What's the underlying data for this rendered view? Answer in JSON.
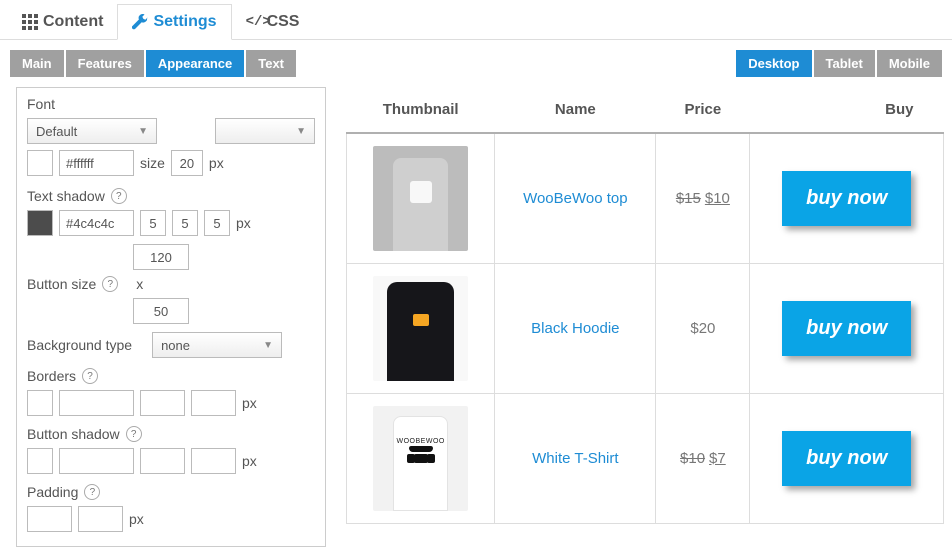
{
  "topTabs": {
    "content": "Content",
    "settings": "Settings",
    "css": "CSS"
  },
  "subTabs": {
    "main": "Main",
    "features": "Features",
    "appearance": "Appearance",
    "text": "Text"
  },
  "devTabs": {
    "desktop": "Desktop",
    "tablet": "Tablet",
    "mobile": "Mobile"
  },
  "labels": {
    "font": "Font",
    "size": "size",
    "px": "px",
    "textShadow": "Text shadow",
    "buttonSize": "Button size",
    "x": "x",
    "backgroundType": "Background type",
    "borders": "Borders",
    "buttonShadow": "Button shadow",
    "padding": "Padding"
  },
  "form": {
    "fontSelect": "Default",
    "fontColor": "#ffffff",
    "fontSize": "20",
    "shadowColor": "#4c4c4c",
    "shadowA": "5",
    "shadowB": "5",
    "shadowC": "5",
    "btnW": "120",
    "btnH": "50",
    "bgType": "none"
  },
  "table": {
    "headers": {
      "thumbnail": "Thumbnail",
      "name": "Name",
      "price": "Price",
      "buy": "Buy"
    },
    "buyLabel": "buy now",
    "rows": [
      {
        "name": "WooBeWoo top",
        "old": "$15",
        "new": "$10",
        "thumb": "tee-grey"
      },
      {
        "name": "Black Hoodie",
        "price": "$20",
        "thumb": "hdy"
      },
      {
        "name": "White T-Shirt",
        "old": "$10",
        "new": "$7",
        "thumb": "tee-white"
      }
    ]
  }
}
